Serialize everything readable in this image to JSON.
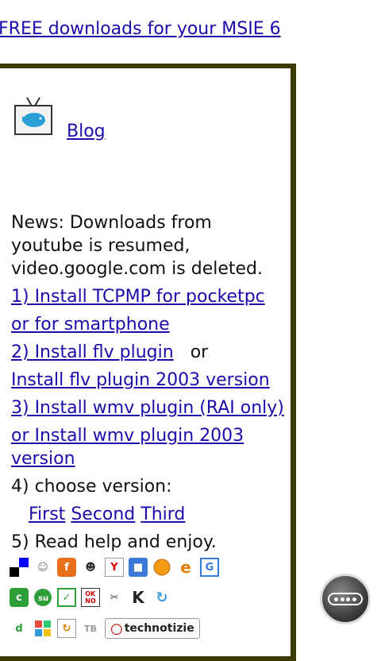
{
  "header": {
    "link_text": "FREE downloads for your MSIE 6"
  },
  "blog": {
    "label": "Blog"
  },
  "news": {
    "text": "News: Downloads from youtube is resumed,  video.google.com is deleted."
  },
  "steps": {
    "install_tcpmp": "1) Install TCPMP for pocketpc",
    "smartphone": "or for smartphone",
    "install_flv": "2) Install flv plugin",
    "or": "or",
    "install_flv_2003": "Install flv plugin 2003 version",
    "install_wmv": "3) Install wmv plugin (RAI only)",
    "install_wmv_2003": "or Install wmv plugin 2003 version",
    "choose": "4) choose version:",
    "version_first": "First",
    "version_second": "Second",
    "version_third": "Third",
    "read_help": "5) Read help and enjoy."
  },
  "badges": {
    "tb_label": "TB",
    "technotizie_label": "technotizie"
  },
  "colors": {
    "link": "#1a0dab",
    "panel_border": "#3b3a00"
  },
  "icons": [
    "delicious-icon",
    "people-icon",
    "furl-icon",
    "reddit-icon",
    "yahoo-icon",
    "robot-icon",
    "orange-dot-icon",
    "ie-icon",
    "google-icon",
    "connotea-icon",
    "stumbleupon-icon",
    "checkmark-icon",
    "okno-icon",
    "scissors-icon",
    "k-icon",
    "spiral-icon",
    "digg-icon",
    "windows-icon",
    "rss-icon",
    "technotizie-icon",
    "more-options-icon"
  ]
}
